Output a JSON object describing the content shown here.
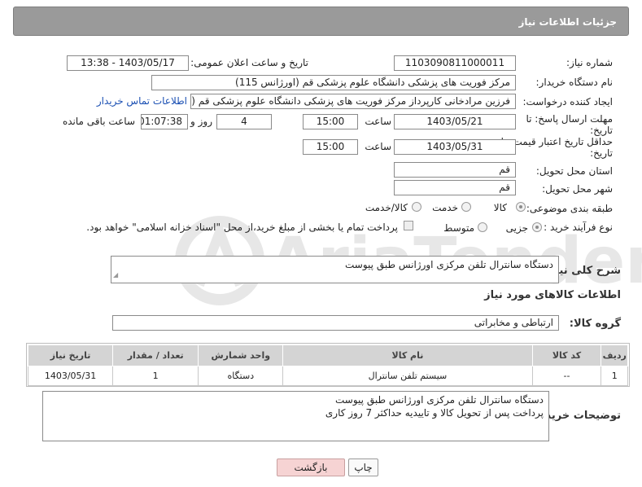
{
  "header": {
    "title": "جزئیات اطلاعات نیاز"
  },
  "need_number": {
    "label": "شماره نیاز:",
    "value": "1103090811000011"
  },
  "announce_datetime": {
    "label": "تاریخ و ساعت اعلان عمومی:",
    "value": "1403/05/17 - 13:38"
  },
  "buyer_org": {
    "label": "نام دستگاه خریدار:",
    "value": "مرکز فوریت های پزشکی دانشگاه علوم پزشکی قم (اورژانس 115)"
  },
  "requester": {
    "label": "ایجاد کننده درخواست:",
    "value": "فرزین مرادخانی کارپرداز مرکز فوریت های پزشکی دانشگاه علوم پزشکی قم (اور",
    "contact_link": "اطلاعات تماس خریدار"
  },
  "reply_deadline": {
    "label_line1": "مهلت ارسال پاسخ: تا",
    "label_line2": "تاریخ:",
    "date": "1403/05/21",
    "time_label": "ساعت",
    "time": "15:00",
    "days": "4",
    "days_label": "روز و",
    "remaining": "01:07:38",
    "remaining_label": "ساعت باقی مانده"
  },
  "price_validity": {
    "label_line1": "حداقل تاریخ اعتبار قیمت: تا",
    "label_line2": "تاریخ:",
    "date": "1403/05/31",
    "time_label": "ساعت",
    "time": "15:00"
  },
  "delivery_province": {
    "label": "استان محل تحویل:",
    "value": "قم"
  },
  "delivery_city": {
    "label": "شهر محل تحویل:",
    "value": "قم"
  },
  "category": {
    "label": "طبقه بندی موضوعی:",
    "options": [
      "کالا",
      "خدمت",
      "کالا/خدمت"
    ],
    "selected": "کالا"
  },
  "purchase_process": {
    "label": "نوع فرآیند خرید :",
    "options": [
      "جزیی",
      "متوسط"
    ],
    "selected": "جزیی",
    "payment_note": "پرداخت تمام یا بخشی از مبلغ خرید،از محل \"اسناد خزانه اسلامی\" خواهد بود."
  },
  "general_description": {
    "label": "شرح کلی نیاز:",
    "value": "دستگاه سانترال تلفن مرکزی اورژانس طبق پیوست"
  },
  "goods_section": {
    "title": "اطلاعات کالاهای مورد نیاز"
  },
  "goods_group": {
    "label": "گروه کالا:",
    "value": "ارتباطی و مخابراتی"
  },
  "items_table": {
    "headers": [
      "ردیف",
      "کد کالا",
      "نام کالا",
      "واحد شمارش",
      "تعداد / مقدار",
      "تاریخ نیاز"
    ],
    "rows": [
      [
        "1",
        "--",
        "سیستم تلفن سانترال",
        "دستگاه",
        "1",
        "1403/05/31"
      ]
    ]
  },
  "buyer_notes": {
    "label": "توضیحات خریدار:",
    "line1": "دستگاه سانترال تلفن مرکزی اورژانس طبق پیوست",
    "line2": "پرداخت پس از تحویل کالا و تاییدیه حداکثر 7 روز کاری"
  },
  "buttons": {
    "print": "چاپ",
    "back": "بازگشت"
  },
  "watermark_text": "AriaTender.neT",
  "colors": {
    "header_bg": "#9a9a9a",
    "link": "#1a4fb3",
    "back_button_bg": "#f6d3d3",
    "table_header_bg": "#d4d4d4"
  }
}
